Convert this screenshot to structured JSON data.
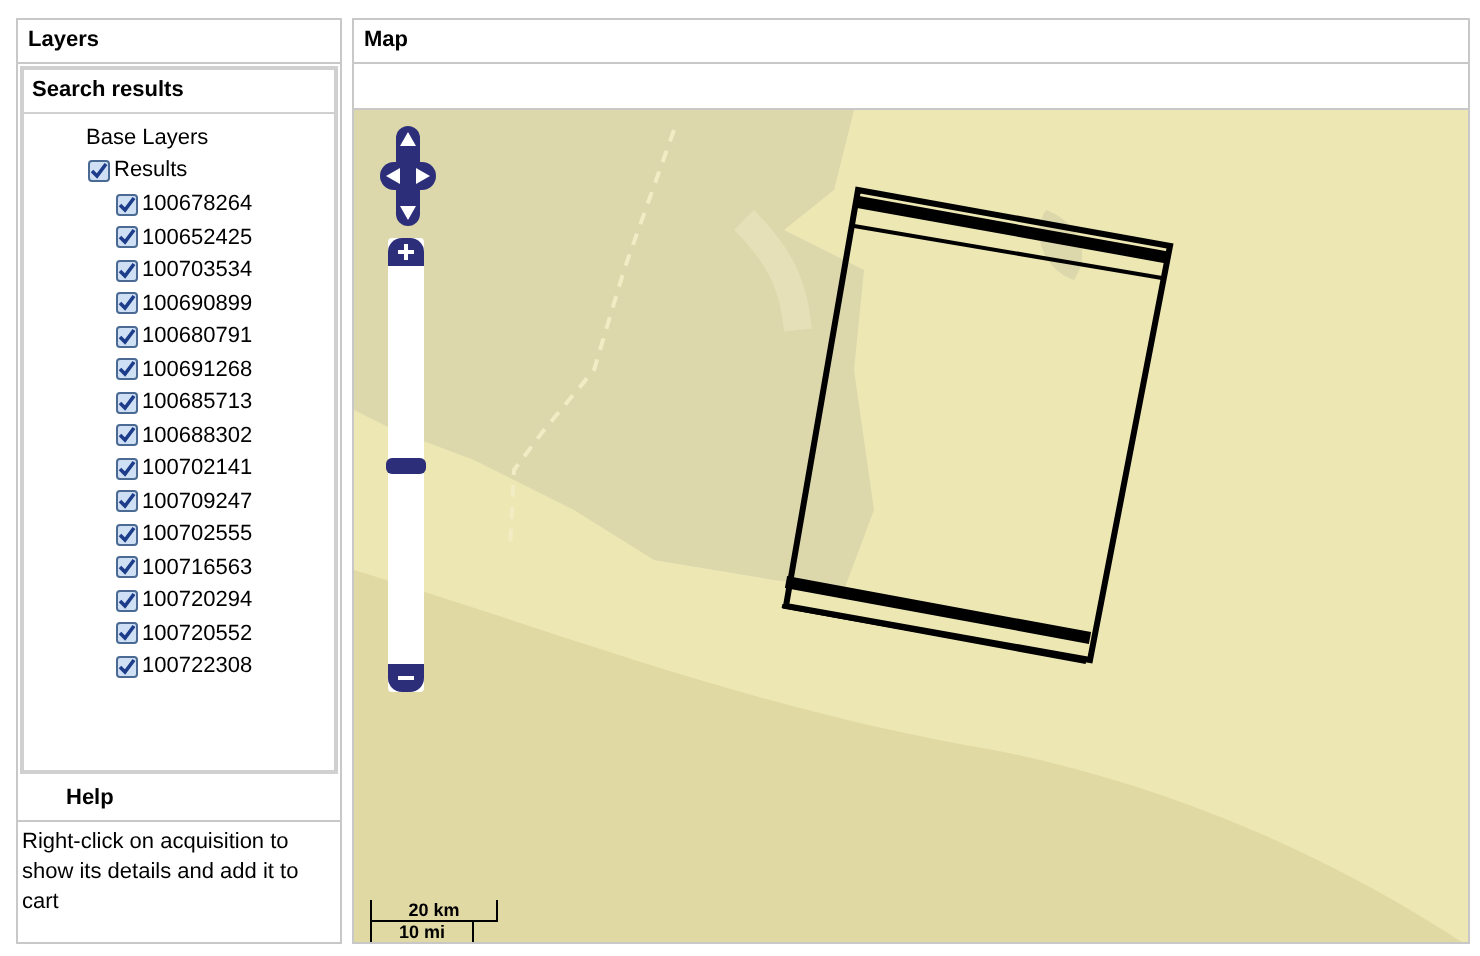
{
  "layers_panel": {
    "title": "Layers"
  },
  "search_results": {
    "title": "Search results",
    "base_layers": {
      "label": "Base Layers"
    },
    "results": {
      "label": "Results",
      "checked": true,
      "children": [
        {
          "label": "100678264",
          "checked": true
        },
        {
          "label": "100652425",
          "checked": true
        },
        {
          "label": "100703534",
          "checked": true
        },
        {
          "label": "100690899",
          "checked": true
        },
        {
          "label": "100680791",
          "checked": true
        },
        {
          "label": "100691268",
          "checked": true
        },
        {
          "label": "100685713",
          "checked": true
        },
        {
          "label": "100688302",
          "checked": true
        },
        {
          "label": "100702141",
          "checked": true
        },
        {
          "label": "100709247",
          "checked": true
        },
        {
          "label": "100702555",
          "checked": true
        },
        {
          "label": "100716563",
          "checked": true
        },
        {
          "label": "100720294",
          "checked": true
        },
        {
          "label": "100720552",
          "checked": true
        },
        {
          "label": "100722308",
          "checked": true
        }
      ]
    }
  },
  "help": {
    "title": "Help",
    "text": "Right-click on acquisition to show its details and add it to cart"
  },
  "map": {
    "title": "Map",
    "zoom": {
      "level": 0.5
    },
    "scale_bar": {
      "metric": "20 km",
      "imperial": "10 mi"
    }
  }
}
